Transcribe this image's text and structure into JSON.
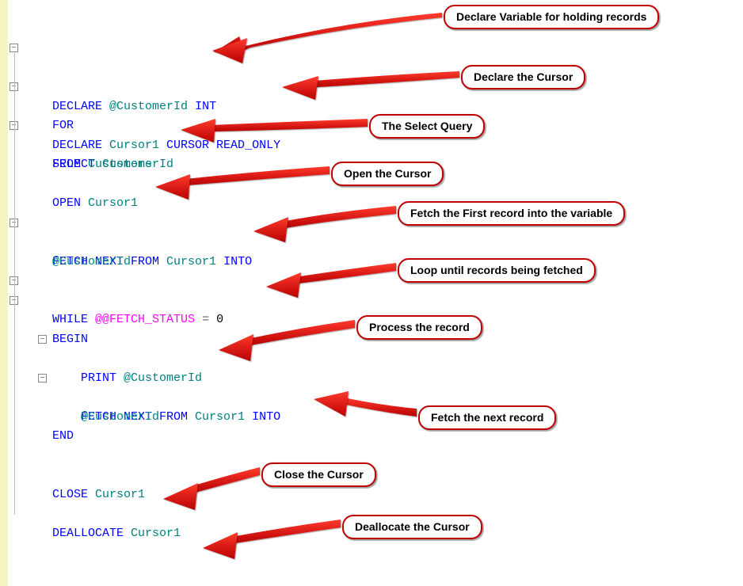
{
  "code": {
    "l1": {
      "kw": "DECLARE ",
      "ident": "@CustomerId ",
      "type": "INT"
    },
    "l2": {
      "kw": "DECLARE ",
      "ident": "Cursor1 ",
      "kw2": "CURSOR READ_ONLY"
    },
    "l3": {
      "kw": "FOR"
    },
    "l4": {
      "kw": "SELECT ",
      "ident": "CustomerId"
    },
    "l5": {
      "kw": "FROM ",
      "ident": "Customers"
    },
    "l6": {
      "kw": "OPEN ",
      "ident": "Cursor1"
    },
    "l7": {
      "kw": "FETCH NEXT FROM ",
      "ident": "Cursor1 ",
      "kw2": "INTO"
    },
    "l8": {
      "ident": "@CustomerId"
    },
    "l9": {
      "kw": "WHILE ",
      "sys": "@@FETCH_STATUS ",
      "op": "= ",
      "num": "0"
    },
    "l10": {
      "kw": "BEGIN"
    },
    "l11": {
      "kw": "    PRINT ",
      "ident": "@CustomerId"
    },
    "l12": {
      "kw": "    FETCH NEXT FROM ",
      "ident": "Cursor1 ",
      "kw2": "INTO"
    },
    "l13": {
      "ident": "    @CustomerId"
    },
    "l14": {
      "kw": "END"
    },
    "l15": {
      "kw": "CLOSE ",
      "ident": "Cursor1"
    },
    "l16": {
      "kw": "DEALLOCATE ",
      "ident": "Cursor1"
    }
  },
  "callouts": {
    "c1": "Declare Variable for holding records",
    "c2": "Declare the Cursor",
    "c3": "The Select Query",
    "c4": "Open the Cursor",
    "c5": "Fetch the First record into the variable",
    "c6": "Loop until records being fetched",
    "c7": "Process the record",
    "c8": "Fetch the next record",
    "c9": "Close the Cursor",
    "c10": "Deallocate the Cursor"
  }
}
